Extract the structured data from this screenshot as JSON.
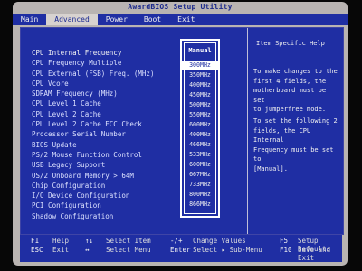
{
  "window_title": "AwardBIOS Setup Utility",
  "menu": [
    "Main",
    "Advanced",
    "Power",
    "Boot",
    "Exit"
  ],
  "active_menu": "Advanced",
  "settings": [
    "CPU Internal Frequency",
    "CPU Frequency Multiple",
    "CPU External (FSB) Freq. (MHz)",
    "CPU Vcore",
    "SDRAM Frequency (MHz)",
    "CPU Level 1 Cache",
    "CPU Level 2 Cache",
    "CPU Level 2 Cache ECC Check",
    "Processor Serial Number",
    "BIOS Update",
    "PS/2 Mouse Function Control",
    "USB Legacy Support",
    "OS/2 Onboard Memory > 64M",
    "Chip Configuration",
    "I/O Device Configuration",
    "PCI Configuration",
    "Shadow Configuration"
  ],
  "popup_title": "Manual",
  "popup_options": [
    "300MHz",
    "350MHz",
    "400MHz",
    "450MHz",
    "500MHz",
    "550MHz",
    "600MHz",
    "400MHz",
    "466MHz",
    "533MHz",
    "600MHz",
    "667MHz",
    "733MHz",
    "800MHz",
    "866MHz"
  ],
  "selected_option": "300MHz",
  "help_title": "Item Specific Help",
  "help_text_1": "To make changes to the\nfirst 4 fields, the\nmotherboard must be set\nto jumperfree mode.",
  "help_text_2": "To set the following 2\nfields, the CPU Internal\nFrequency must be set to\n[Manual].",
  "footer": {
    "f1": "F1",
    "help": "Help",
    "arrows_updown": "↑↓",
    "select_item": "Select Item",
    "minus_plus": "-/+",
    "change_values": "Change Values",
    "f5": "F5",
    "setup_defaults": "Setup Defaults",
    "esc": "ESC",
    "exit": "Exit",
    "arrows_leftright": "↔",
    "select_menu": "Select Menu",
    "enter": "Enter",
    "select_submenu": "Select ▸ Sub-Menu",
    "f10": "F10",
    "save_exit": "Save and Exit"
  }
}
